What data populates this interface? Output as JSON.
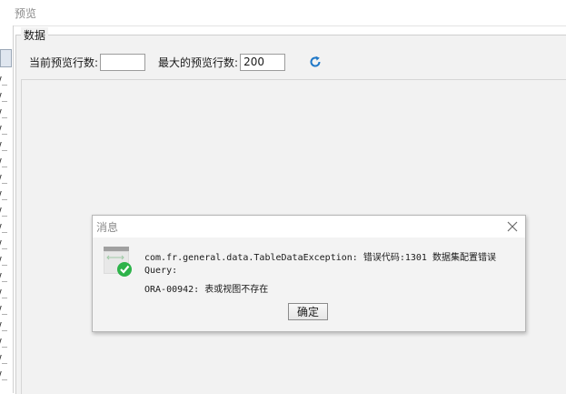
{
  "window": {
    "title": "预览"
  },
  "group": {
    "legend": "数据"
  },
  "controls": {
    "current_rows_label": "当前预览行数:",
    "current_rows_value": "",
    "max_rows_label": "最大的预览行数:",
    "max_rows_value": "200",
    "refresh_icon": "refresh-icon"
  },
  "left_strip": {
    "row_text": "V_"
  },
  "dialog": {
    "title": "消息",
    "message_line1": "com.fr.general.data.TableDataException: 错误代码:1301 数据集配置错误",
    "message_line2": "Query:",
    "message_line3": "ORA-00942: 表或视图不存在",
    "ok_label": "确定"
  },
  "colors": {
    "accent": "#1f78c8",
    "check_green": "#2db34a"
  }
}
